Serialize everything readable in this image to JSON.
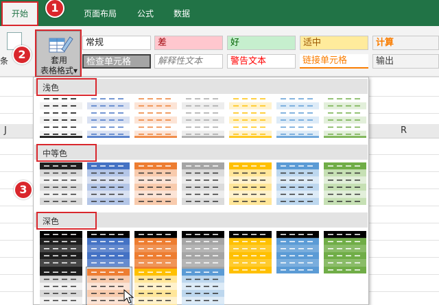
{
  "tabs": [
    {
      "label": "开始",
      "active": true
    },
    {
      "label": "页面布局"
    },
    {
      "label": "公式"
    },
    {
      "label": "数据"
    }
  ],
  "markers": [
    "1",
    "2",
    "3"
  ],
  "ribbon": {
    "conditional_label": "条",
    "format_as_table_line1": "套用",
    "format_as_table_line2": "表格格式",
    "dropdown_caret": "▾",
    "cell_styles": [
      {
        "label": "常规",
        "bg": "#ffffff",
        "color": "#222222"
      },
      {
        "label": "差",
        "bg": "#ffc7ce",
        "color": "#9c0006"
      },
      {
        "label": "好",
        "bg": "#c6efce",
        "color": "#006100"
      },
      {
        "label": "适中",
        "bg": "#ffeb9c",
        "color": "#9c5700"
      },
      {
        "label": "计算",
        "bg": "#f2f2f2",
        "color": "#fa7d00"
      },
      {
        "label": "检查单元格",
        "bg": "#a5a5a5",
        "color": "#ffffff"
      },
      {
        "label": "解释性文本",
        "bg": "#ffffff",
        "color": "#7f7f7f"
      },
      {
        "label": "警告文本",
        "bg": "#ffffff",
        "color": "#ff0000"
      },
      {
        "label": "链接单元格",
        "bg": "#ffffff",
        "color": "#fa7d00"
      },
      {
        "label": "输出",
        "bg": "#f2f2f2",
        "color": "#3f3f3f"
      }
    ]
  },
  "sheet": {
    "col_left": "J",
    "col_right": "R"
  },
  "gallery": {
    "sections": [
      {
        "label": "浅色"
      },
      {
        "label": "中等色"
      },
      {
        "label": "深色"
      }
    ],
    "palette": {
      "black": "#1f1f1f",
      "blue": "#4472c4",
      "orange": "#ed7d31",
      "gray": "#a5a5a5",
      "gold": "#ffc000",
      "lightblue": "#5b9bd5",
      "green": "#70ad47"
    }
  }
}
